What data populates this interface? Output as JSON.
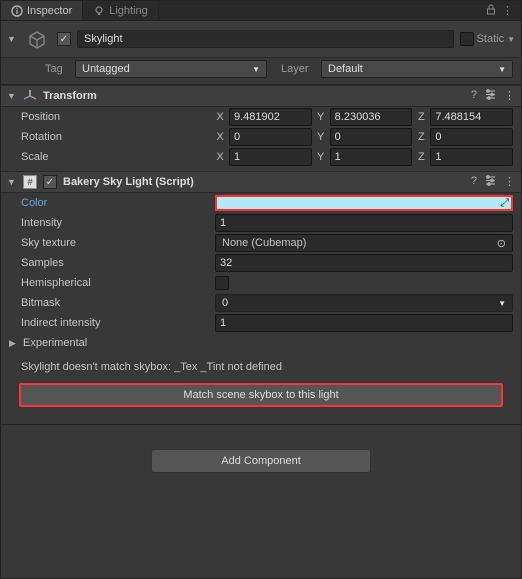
{
  "tabs": {
    "inspector": "Inspector",
    "lighting": "Lighting"
  },
  "header": {
    "name": "Skylight",
    "static": "Static",
    "tagLabel": "Tag",
    "tagValue": "Untagged",
    "layerLabel": "Layer",
    "layerValue": "Default"
  },
  "transform": {
    "title": "Transform",
    "position": {
      "label": "Position",
      "x": "9.481902",
      "y": "8.230036",
      "z": "7.488154"
    },
    "rotation": {
      "label": "Rotation",
      "x": "0",
      "y": "0",
      "z": "0"
    },
    "scale": {
      "label": "Scale",
      "x": "1",
      "y": "1",
      "z": "1"
    },
    "xl": "X",
    "yl": "Y",
    "zl": "Z"
  },
  "skylight": {
    "title": "Bakery Sky Light (Script)",
    "color": {
      "label": "Color",
      "value": "#b5e8f5"
    },
    "intensity": {
      "label": "Intensity",
      "value": "1"
    },
    "skyTexture": {
      "label": "Sky texture",
      "value": "None (Cubemap)"
    },
    "samples": {
      "label": "Samples",
      "value": "32"
    },
    "hemi": {
      "label": "Hemispherical"
    },
    "bitmask": {
      "label": "Bitmask",
      "value": "0"
    },
    "indirect": {
      "label": "Indirect intensity",
      "value": "1"
    },
    "experimental": "Experimental",
    "warning": "Skylight doesn't match skybox: _Tex _Tint not defined",
    "matchBtn": "Match scene skybox to this light"
  },
  "addComponent": "Add Component"
}
